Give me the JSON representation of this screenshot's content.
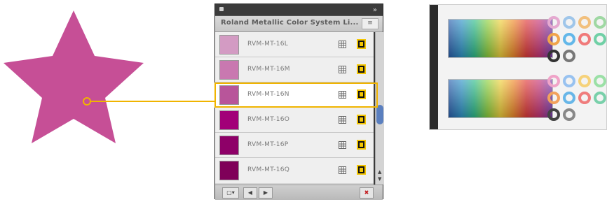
{
  "panel": {
    "title": "Roland Metallic Color System Li...",
    "menu_label": "≡",
    "swatches": [
      {
        "name": "RVM-MT-16L",
        "color": "#d39bc3"
      },
      {
        "name": "RVM-MT-16M",
        "color": "#c978b0"
      },
      {
        "name": "RVM-MT-16N",
        "color": "#b8559a"
      },
      {
        "name": "RVM-MT-16O",
        "color": "#a20078"
      },
      {
        "name": "RVM-MT-16P",
        "color": "#8e0068"
      },
      {
        "name": "RVM-MT-16Q",
        "color": "#7f0059"
      }
    ],
    "bottom_buttons": [
      "▢▾",
      "◀",
      "▶"
    ],
    "delete_icon": "✖"
  },
  "star": {
    "color": "#c64f96"
  },
  "highlight": {
    "color": "#f0b400"
  },
  "chart_thumbnail": {
    "icons": [
      "color-ring-icon"
    ]
  }
}
